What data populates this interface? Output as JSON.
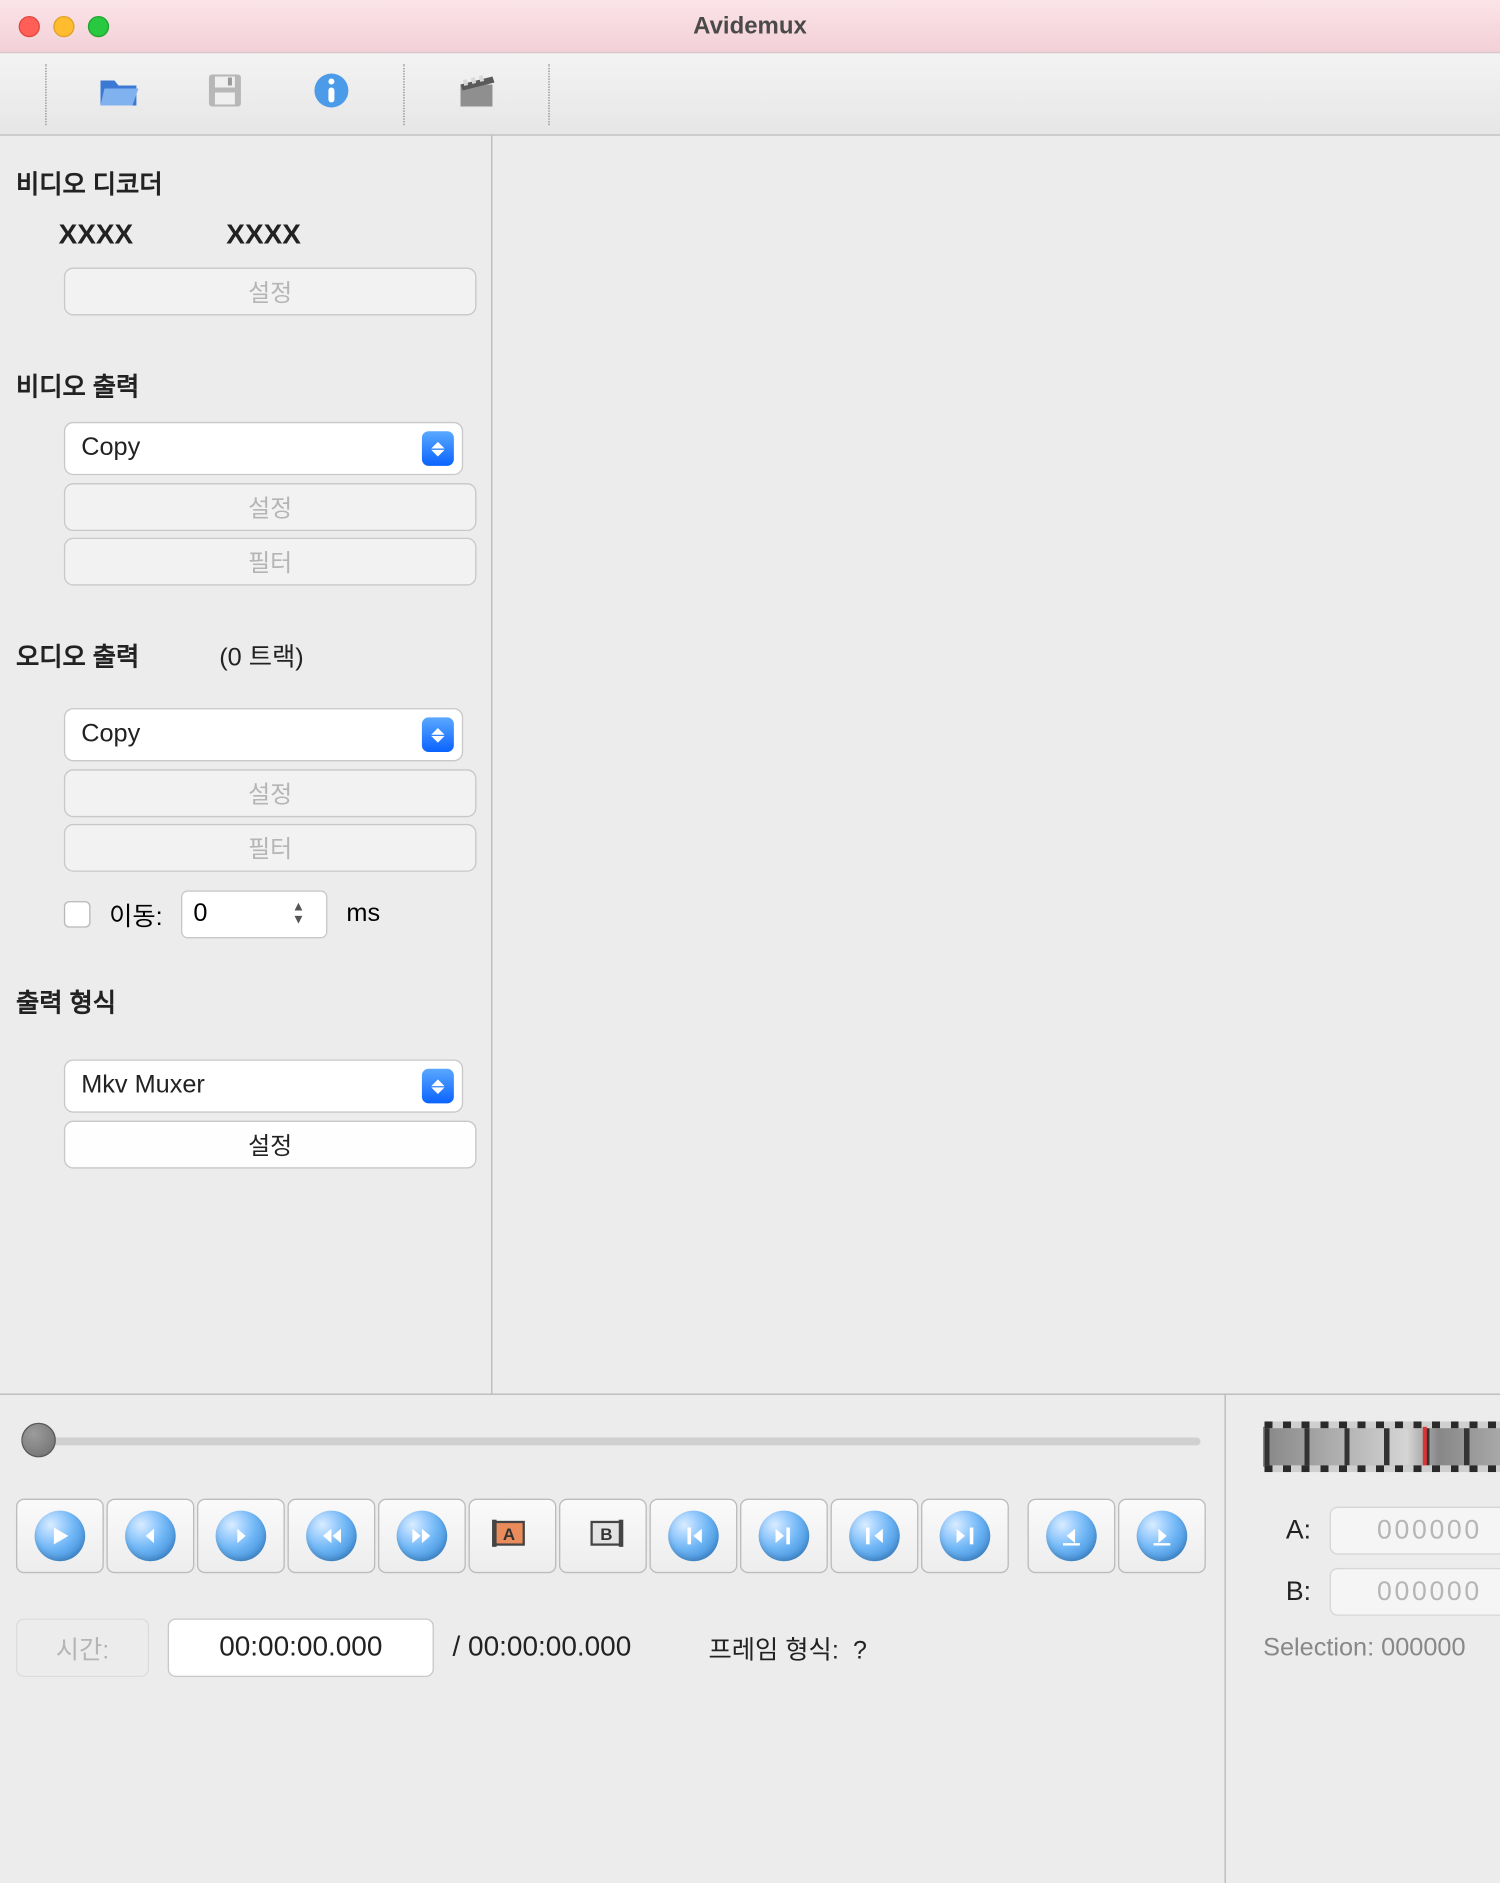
{
  "window": {
    "title": "Avidemux"
  },
  "toolbar": {
    "open_icon": "folder-open-icon",
    "save_icon": "floppy-disk-icon",
    "info_icon": "info-icon",
    "clapper_icon": "clapperboard-icon"
  },
  "sidebar": {
    "decoder": {
      "title": "비디오 디코더",
      "val1": "XXXX",
      "val2": "XXXX",
      "configure": "설정"
    },
    "video_out": {
      "title": "비디오 출력",
      "codec": "Copy",
      "configure": "설정",
      "filters": "필터"
    },
    "audio_out": {
      "title": "오디오 출력",
      "tracks": "(0 트랙)",
      "codec": "Copy",
      "configure": "설정",
      "filters": "필터",
      "shift_label": "이동:",
      "shift_value": "0",
      "shift_unit": "ms"
    },
    "output_format": {
      "title": "출력 형식",
      "muxer": "Mkv Muxer",
      "configure": "설정"
    }
  },
  "timeline": {
    "time_label": "시간:",
    "time_value": "00:00:00.000",
    "time_total": "/ 00:00:00.000",
    "frame_type_label": "프레임 형식:",
    "frame_type_value": "?"
  },
  "markers": {
    "a_label": "A:",
    "a_value": "000000",
    "b_label": "B:",
    "b_value": "000000",
    "selection": "Selection: 000000"
  }
}
